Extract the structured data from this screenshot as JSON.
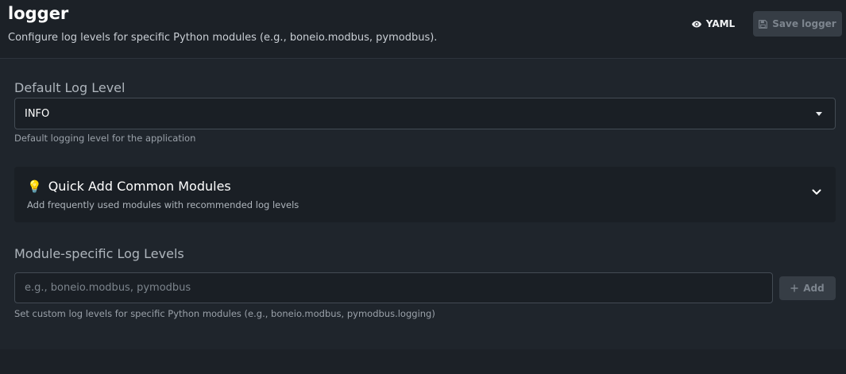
{
  "header": {
    "title": "logger",
    "subtitle": "Configure log levels for specific Python modules (e.g., boneio.modbus, pymodbus).",
    "yaml_label": "YAML",
    "save_label": "Save logger"
  },
  "default_level": {
    "label": "Default Log Level",
    "value": "INFO",
    "help": "Default logging level for the application"
  },
  "quick_add": {
    "emoji": "💡",
    "title": "Quick Add Common Modules",
    "subtitle": "Add frequently used modules with recommended log levels"
  },
  "modules": {
    "label": "Module-specific Log Levels",
    "placeholder": "e.g., boneio.modbus, pymodbus",
    "add_label": "Add",
    "help": "Set custom log levels for specific Python modules (e.g., boneio.modbus, pymodbus.logging)"
  },
  "icons": {
    "yaml": "eye-icon",
    "save": "floppy-disk-icon",
    "select": "caret-down-icon",
    "quick_add": "chevron-down-icon",
    "add": "plus-icon"
  }
}
